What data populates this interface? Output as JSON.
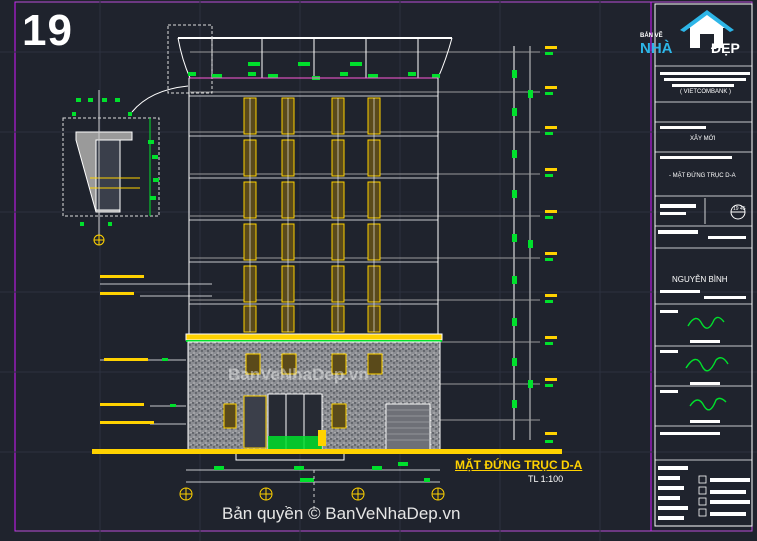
{
  "sheet_number": "19",
  "logo": {
    "line1": "BẢN VẼ",
    "line2": "NHÀ",
    "line3": "ĐẸP",
    "icon": "house-icon"
  },
  "title_block": {
    "project_sub": "( VIETCOMBANK )",
    "work": "XÂY MỚI",
    "drawing_name": "- MẶT ĐỨNG TRỤC D-A",
    "sheet_badge": "19 45",
    "person": "NGUYỄN BÌNH"
  },
  "elevation": {
    "title": "MẶT ĐỨNG TRỤC D-A",
    "scale": "TL 1:100"
  },
  "watermarks": {
    "center": "BanVeNhaDep.vn",
    "copyright": "Bản quyền © BanVeNhaDep.vn"
  },
  "colors": {
    "background": "#1f232d",
    "line_white": "#ffffff",
    "dim_green": "#00e02c",
    "note_yellow": "#ffd200",
    "border_magenta": "#d01aff",
    "accent_cyan": "#2db6e8"
  }
}
